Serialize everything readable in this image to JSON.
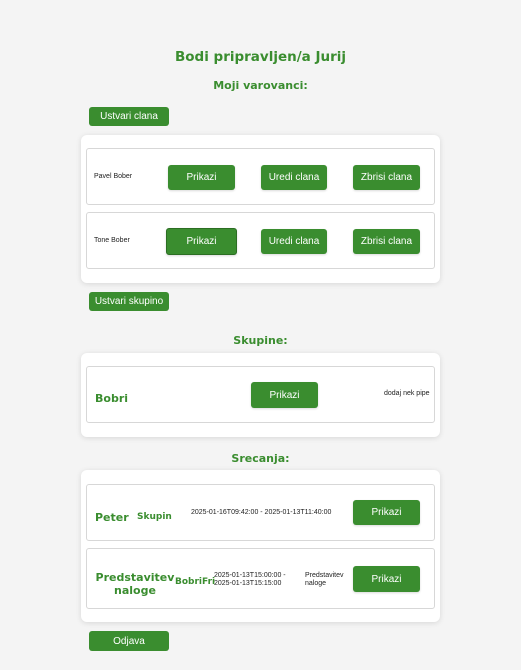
{
  "header": {
    "title": "Bodi pripravljen/a Jurij",
    "wards_heading": "Moji varovanci:"
  },
  "wards": {
    "create_member_label": "Ustvari clana",
    "members": [
      {
        "name": "Pavel Bober",
        "view_label": "Prikazi",
        "edit_label": "Uredi clana",
        "delete_label": "Zbrisi clana"
      },
      {
        "name": "Tone Bober",
        "view_label": "Prikazi",
        "edit_label": "Uredi clana",
        "delete_label": "Zbrisi clana"
      }
    ],
    "create_group_label": "Ustvari skupino"
  },
  "groups": {
    "heading": "Skupine:",
    "items": [
      {
        "name": "Bobri",
        "view_label": "Prikazi",
        "note": "dodaj nek pipe"
      }
    ]
  },
  "meetings": {
    "heading": "Srecanja:",
    "items": [
      {
        "name": "Peter",
        "group": "Skupin",
        "time": "2025-01-16T09:42:00 - 2025-01-13T11:40:00",
        "note": "",
        "view_label": "Prikazi"
      },
      {
        "name": "Predstavitev naloge",
        "group": "BobriFri",
        "time": "2025-01-13T15:00:00 - 2025-01-13T15:15:00",
        "note": "Predstavitev naloge",
        "view_label": "Prikazi"
      }
    ]
  },
  "footer": {
    "logout_label": "Odjava"
  },
  "colors": {
    "accent": "#3a8d2f",
    "background": "#f4f4f4",
    "card": "#ffffff"
  }
}
